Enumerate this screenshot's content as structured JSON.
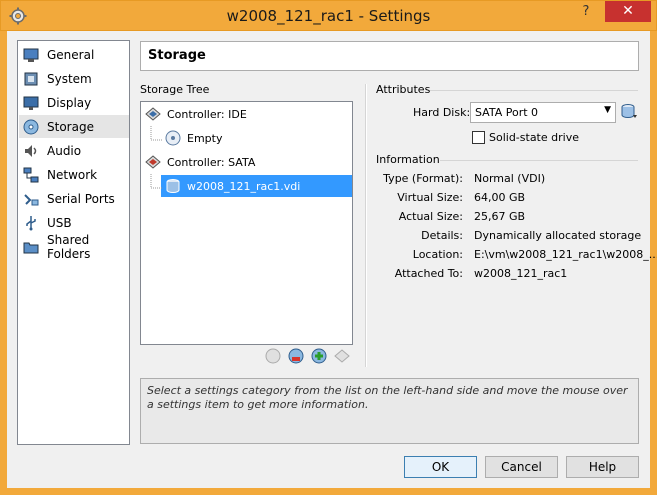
{
  "window": {
    "title": "w2008_121_rac1 - Settings",
    "help_glyph": "?",
    "close_glyph": "✕"
  },
  "categories": [
    {
      "label": "General",
      "icon": "general-icon"
    },
    {
      "label": "System",
      "icon": "system-icon"
    },
    {
      "label": "Display",
      "icon": "display-icon"
    },
    {
      "label": "Storage",
      "icon": "storage-icon",
      "selected": true
    },
    {
      "label": "Audio",
      "icon": "audio-icon"
    },
    {
      "label": "Network",
      "icon": "network-icon"
    },
    {
      "label": "Serial Ports",
      "icon": "serial-ports-icon"
    },
    {
      "label": "USB",
      "icon": "usb-icon"
    },
    {
      "label": "Shared Folders",
      "icon": "shared-folders-icon"
    }
  ],
  "page": {
    "title": "Storage"
  },
  "storage_tree": {
    "label": "Storage Tree",
    "items": [
      {
        "label": "Controller: IDE"
      },
      {
        "label": "Empty"
      },
      {
        "label": "Controller: SATA"
      },
      {
        "label": "w2008_121_rac1.vdi",
        "selected": true
      }
    ]
  },
  "attributes": {
    "label": "Attributes",
    "hard_disk_label": "Hard Disk:",
    "hard_disk_value": "SATA Port 0",
    "ssd_label": "Solid-state drive",
    "ssd_checked": false
  },
  "information": {
    "label": "Information",
    "rows": [
      {
        "key": "Type (Format):",
        "value": "Normal (VDI)"
      },
      {
        "key": "Virtual Size:",
        "value": "64,00 GB"
      },
      {
        "key": "Actual Size:",
        "value": "25,67 GB"
      },
      {
        "key": "Details:",
        "value": "Dynamically allocated storage"
      },
      {
        "key": "Location:",
        "value": "E:\\vm\\w2008_121_rac1\\w2008_..."
      },
      {
        "key": "Attached To:",
        "value": "w2008_121_rac1"
      }
    ]
  },
  "help_text": "Select a settings category from the list on the left-hand side and move the mouse over a settings item to get more information.",
  "buttons": {
    "ok": "OK",
    "cancel": "Cancel",
    "help": "Help"
  }
}
